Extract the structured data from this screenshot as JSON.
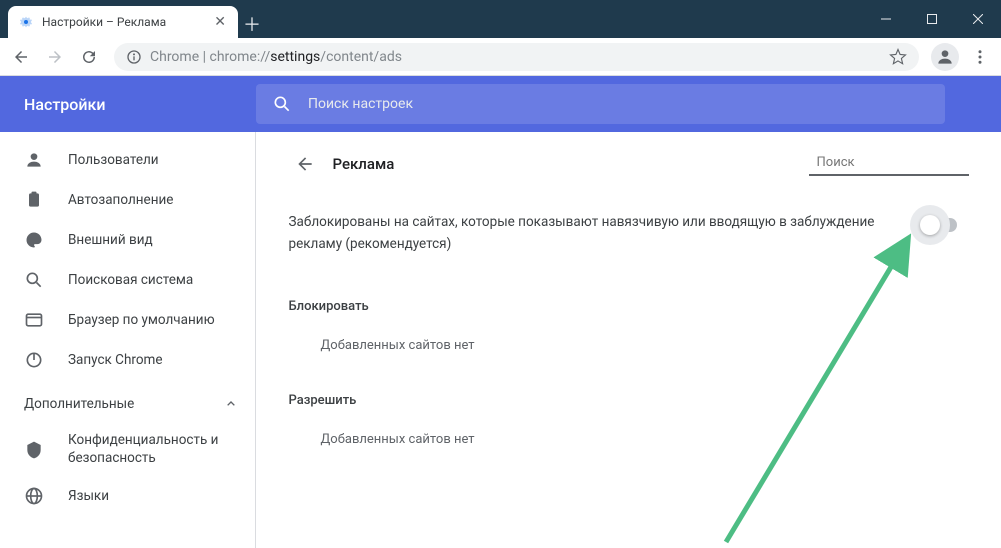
{
  "window": {
    "tab_title": "Настройки – Реклама"
  },
  "omnibox": {
    "prefix": "Chrome",
    "url_scheme": "chrome://",
    "url_bold": "settings",
    "url_rest": "/content/ads"
  },
  "header": {
    "brand": "Настройки",
    "search_placeholder": "Поиск настроек"
  },
  "sidebar": {
    "items": [
      {
        "key": "people",
        "label": "Пользователи"
      },
      {
        "key": "autofill",
        "label": "Автозаполнение"
      },
      {
        "key": "appearance",
        "label": "Внешний вид"
      },
      {
        "key": "search",
        "label": "Поисковая система"
      },
      {
        "key": "default",
        "label": "Браузер по умолчанию"
      },
      {
        "key": "onstartup",
        "label": "Запуск Chrome"
      }
    ],
    "advanced_label": "Дополнительные",
    "advanced": [
      {
        "key": "privacy",
        "label": "Конфиденциальность и безопасность"
      },
      {
        "key": "languages",
        "label": "Языки"
      }
    ]
  },
  "content": {
    "title": "Реклама",
    "search_placeholder": "Поиск",
    "main_setting": "Заблокированы на сайтах, которые показывают навязчивую или вводящую в заблуждение рекламу (рекомендуется)",
    "block_label": "Блокировать",
    "block_empty": "Добавленных сайтов нет",
    "allow_label": "Разрешить",
    "allow_empty": "Добавленных сайтов нет"
  }
}
